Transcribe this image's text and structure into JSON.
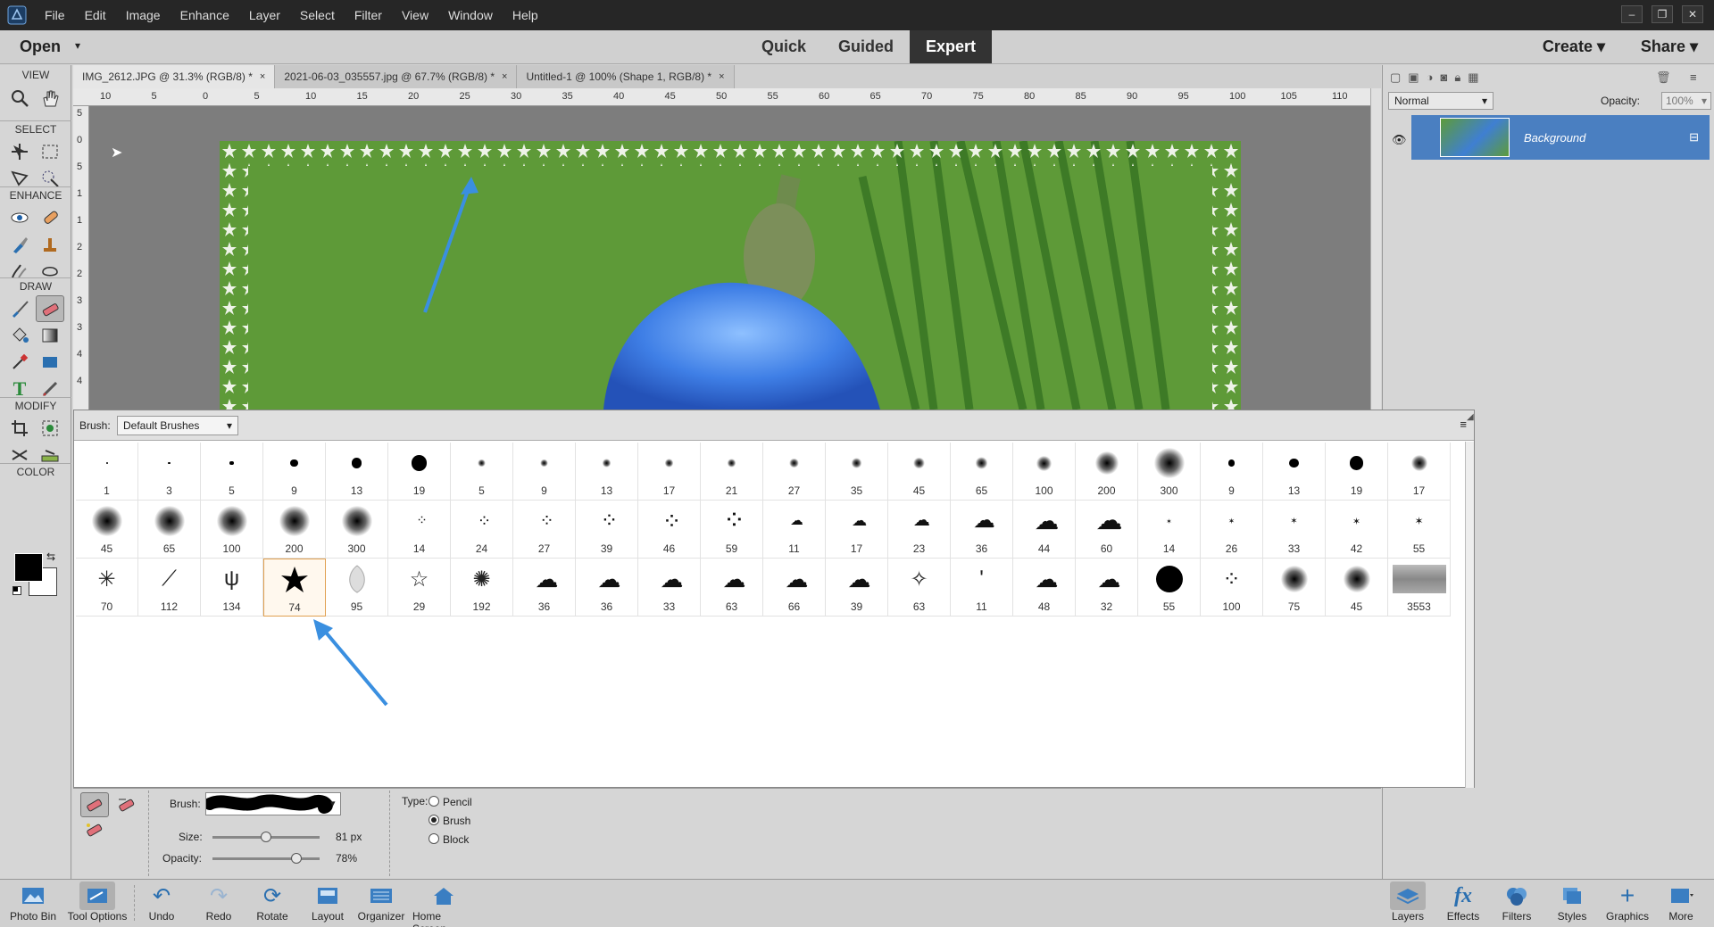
{
  "menu": [
    "File",
    "Edit",
    "Image",
    "Enhance",
    "Layer",
    "Select",
    "Filter",
    "View",
    "Window",
    "Help"
  ],
  "window_controls": [
    "–",
    "❐",
    "✕"
  ],
  "mode_bar": {
    "open_label": "Open",
    "modes": [
      "Quick",
      "Guided",
      "Expert"
    ],
    "active_mode": "Expert",
    "create_label": "Create",
    "share_label": "Share"
  },
  "toolbar": {
    "sections": [
      "VIEW",
      "SELECT",
      "ENHANCE",
      "DRAW",
      "MODIFY",
      "COLOR"
    ]
  },
  "tabs": [
    {
      "label": "IMG_2612.JPG @ 31.3% (RGB/8) *",
      "close": "×"
    },
    {
      "label": "2021-06-03_035557.jpg @ 67.7% (RGB/8) *",
      "close": "×"
    },
    {
      "label": "Untitled-1 @ 100% (Shape 1, RGB/8) *",
      "close": "×"
    }
  ],
  "ruler_h": [
    "10",
    "5",
    "0",
    "5",
    "10",
    "15",
    "20",
    "25",
    "30",
    "35",
    "40",
    "45",
    "50",
    "55",
    "60",
    "65",
    "70",
    "75",
    "80",
    "85",
    "90",
    "95",
    "100",
    "105",
    "110"
  ],
  "ruler_v": [
    "5",
    "0",
    "5",
    "1",
    "1",
    "2",
    "2",
    "3",
    "3",
    "4",
    "4"
  ],
  "layers": {
    "blend_mode": "Normal",
    "opacity_label": "Opacity:",
    "opacity_value": "100%",
    "layer_name": "Background"
  },
  "brush_panel": {
    "label": "Brush:",
    "library": "Default Brushes",
    "rows": [
      [
        "1",
        "3",
        "5",
        "9",
        "13",
        "19",
        "5",
        "9",
        "13",
        "17",
        "21",
        "27",
        "35",
        "45",
        "65",
        "100",
        "200",
        "300",
        "9",
        "13",
        "19",
        "17"
      ],
      [
        "45",
        "65",
        "100",
        "200",
        "300",
        "14",
        "24",
        "27",
        "39",
        "46",
        "59",
        "11",
        "17",
        "23",
        "36",
        "44",
        "60",
        "14",
        "26",
        "33",
        "42",
        "55"
      ],
      [
        "70",
        "112",
        "134",
        "74",
        "95",
        "29",
        "192",
        "36",
        "36",
        "33",
        "63",
        "66",
        "39",
        "63",
        "11",
        "48",
        "32",
        "55",
        "100",
        "75",
        "45",
        "3553"
      ]
    ],
    "selected": "74"
  },
  "tool_options": {
    "brush_label": "Brush:",
    "size_label": "Size:",
    "size_value": "81 px",
    "size_fraction": 0.5,
    "opacity_label": "Opacity:",
    "opacity_value": "78%",
    "opacity_fraction": 0.78,
    "type_label": "Type:",
    "types": [
      "Pencil",
      "Brush",
      "Block"
    ],
    "selected_type": "Brush"
  },
  "taskbar": {
    "left": [
      "Photo Bin",
      "Tool Options",
      "Undo",
      "Redo",
      "Rotate",
      "Layout",
      "Organizer",
      "Home Screen"
    ],
    "right": [
      "Layers",
      "Effects",
      "Filters",
      "Styles",
      "Graphics",
      "More"
    ]
  }
}
